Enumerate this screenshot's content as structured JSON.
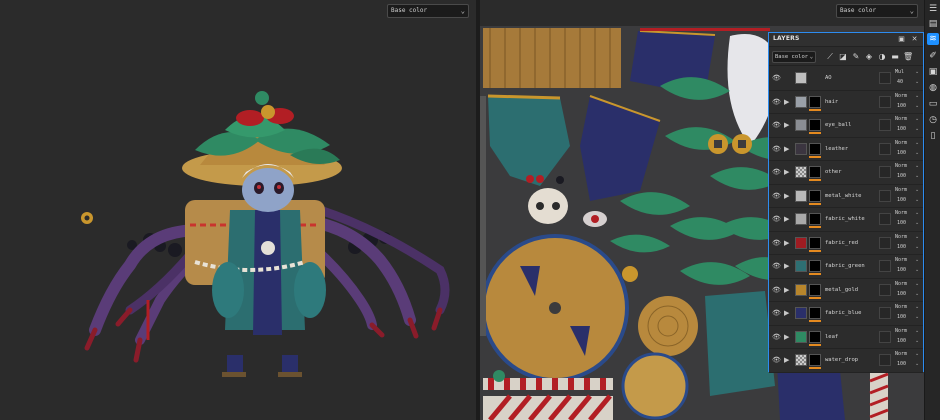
{
  "viewport_3d": {
    "channel_select": "Base color",
    "image": "3d-character-model"
  },
  "viewport_2d": {
    "channel_select": "Base color",
    "image": "uv-texture-atlas"
  },
  "side_toolbar": {
    "icons": [
      "texture-set-list-icon",
      "texture-set-settings-icon",
      "layers-icon",
      "properties-icon",
      "display-settings-icon",
      "shader-settings-icon",
      "shelf-icon",
      "history-icon",
      "log-icon"
    ]
  },
  "layers_panel": {
    "title": "LAYERS",
    "channel_select": "Base color",
    "layers": [
      {
        "name": "AO",
        "blend": "Mul",
        "opacity": "40",
        "thumb_color": "#bfbfbf",
        "type": "fill"
      },
      {
        "name": "hair",
        "blend": "Norm",
        "opacity": "100",
        "thumb_color": "#9aa0a8",
        "type": "folder"
      },
      {
        "name": "eye_ball",
        "blend": "Norm",
        "opacity": "100",
        "thumb_color": "#8a8d93",
        "type": "folder"
      },
      {
        "name": "leather",
        "blend": "Norm",
        "opacity": "100",
        "thumb_color": "#3b3540",
        "type": "folder"
      },
      {
        "name": "other",
        "blend": "Norm",
        "opacity": "100",
        "thumb_color": "checker",
        "type": "folder"
      },
      {
        "name": "metal_white",
        "blend": "Norm",
        "opacity": "100",
        "thumb_color": "#b9b9b9",
        "type": "folder"
      },
      {
        "name": "fabric_white",
        "blend": "Norm",
        "opacity": "100",
        "thumb_color": "#a9a9a9",
        "type": "folder"
      },
      {
        "name": "fabric_red",
        "blend": "Norm",
        "opacity": "100",
        "thumb_color": "#9e1c22",
        "type": "folder"
      },
      {
        "name": "fabric_green",
        "blend": "Norm",
        "opacity": "100",
        "thumb_color": "#2e6f73",
        "type": "folder"
      },
      {
        "name": "metal_gold",
        "blend": "Norm",
        "opacity": "100",
        "thumb_color": "#b8862c",
        "type": "folder"
      },
      {
        "name": "fabric_blue",
        "blend": "Norm",
        "opacity": "100",
        "thumb_color": "#2a2f6a",
        "type": "folder"
      },
      {
        "name": "leaf",
        "blend": "Norm",
        "opacity": "100",
        "thumb_color": "#2f8a63",
        "type": "folder"
      },
      {
        "name": "water_drop",
        "blend": "Norm",
        "opacity": "100",
        "thumb_color": "checker",
        "type": "folder"
      }
    ]
  },
  "colors": {
    "accent": "#2d8cf0",
    "mask_bar": "#e58a1f"
  }
}
